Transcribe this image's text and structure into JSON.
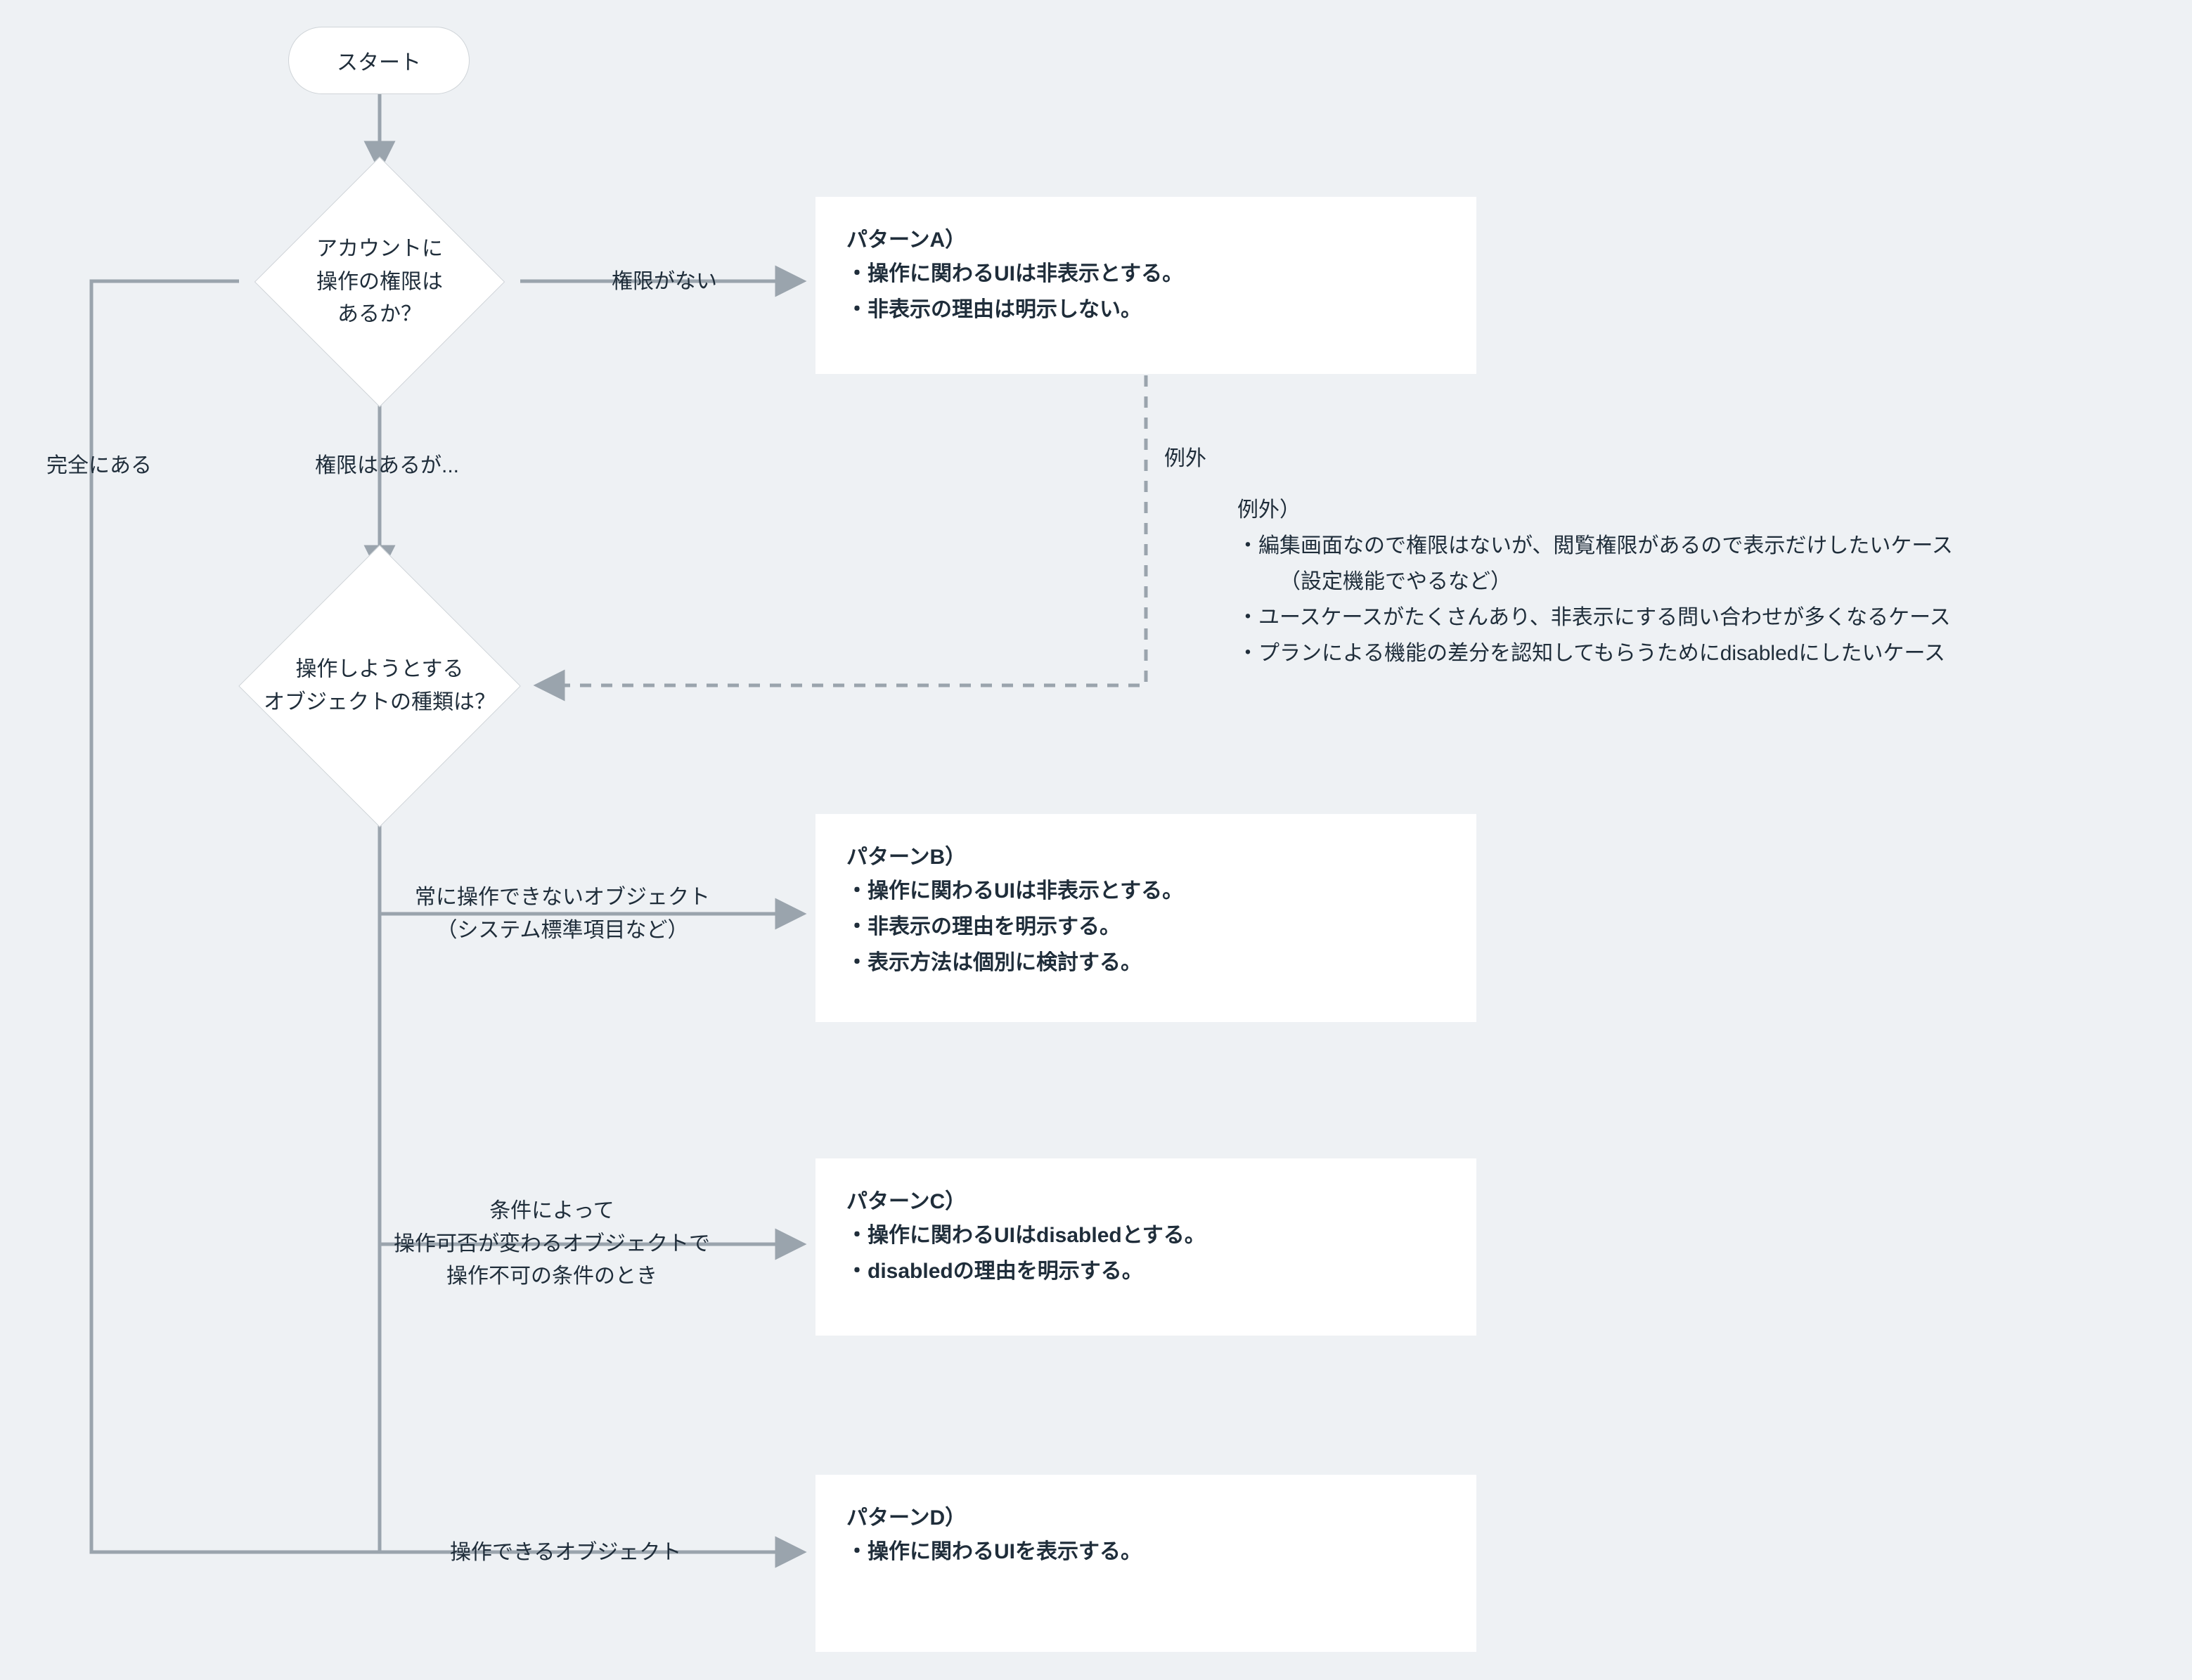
{
  "start": {
    "label": "スタート"
  },
  "decision1": {
    "line1": "アカウントに",
    "line2": "操作の権限は",
    "line3": "あるか？"
  },
  "decision2": {
    "line1": "操作しようとする",
    "line2": "オブジェクトの種類は？"
  },
  "edges": {
    "no_permission": "権限がない",
    "has_but": "権限はあるが...",
    "fully_has": "完全にある",
    "exception": "例外",
    "always_disabled": "常に操作できないオブジェクト\n（システム標準項目など）",
    "conditional": "条件によって\n操作可否が変わるオブジェクトで\n操作不可の条件のとき",
    "operable": "操作できるオブジェクト"
  },
  "patternA": {
    "title": "パターンA）",
    "l1": "・操作に関わるUIは非表示とする。",
    "l2": "・非表示の理由は明示しない。"
  },
  "patternB": {
    "title": "パターンB）",
    "l1": "・操作に関わるUIは非表示とする。",
    "l2": "・非表示の理由を明示する。",
    "l3": "・表示方法は個別に検討する。"
  },
  "patternC": {
    "title": "パターンC）",
    "l1": "・操作に関わるUIはdisabledとする。",
    "l2": "・disabledの理由を明示する。"
  },
  "patternD": {
    "title": "パターンD）",
    "l1": "・操作に関わるUIを表示する。"
  },
  "exceptionNote": {
    "title": "例外）",
    "l1": "・編集画面なので権限はないが、閲覧権限があるので表示だけしたいケース",
    "l1b": "（設定機能でやるなど）",
    "l2": "・ユースケースがたくさんあり、非表示にする問い合わせが多くなるケース",
    "l3": "・プランによる機能の差分を認知してもらうためにdisabledにしたいケース"
  },
  "colors": {
    "bg": "#eef1f4",
    "stroke": "#9aa4ad",
    "text": "#1f2d3a",
    "card": "#ffffff"
  }
}
